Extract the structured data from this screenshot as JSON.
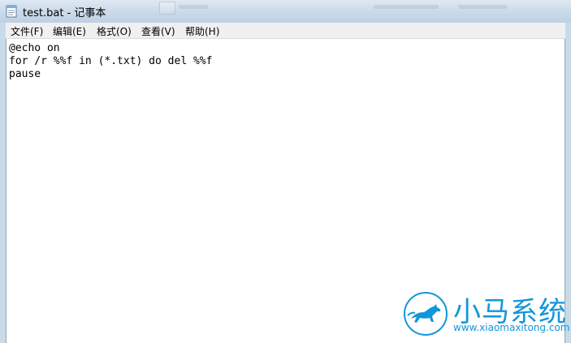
{
  "window": {
    "title": "test.bat - 记事本",
    "app_icon": "notepad-icon"
  },
  "menu": {
    "items": [
      {
        "label": "文件(F)"
      },
      {
        "label": "编辑(E)"
      },
      {
        "label": "格式(O)"
      },
      {
        "label": "查看(V)"
      },
      {
        "label": "帮助(H)"
      }
    ]
  },
  "editor": {
    "lines": [
      "@echo on",
      "for /r %%f in (*.txt) do del %%f",
      "pause"
    ]
  },
  "watermark": {
    "brand": "小马系统",
    "url": "www.xiaomaxitong.com",
    "logo_icon": "horse-logo-icon",
    "color": "#1296db"
  }
}
